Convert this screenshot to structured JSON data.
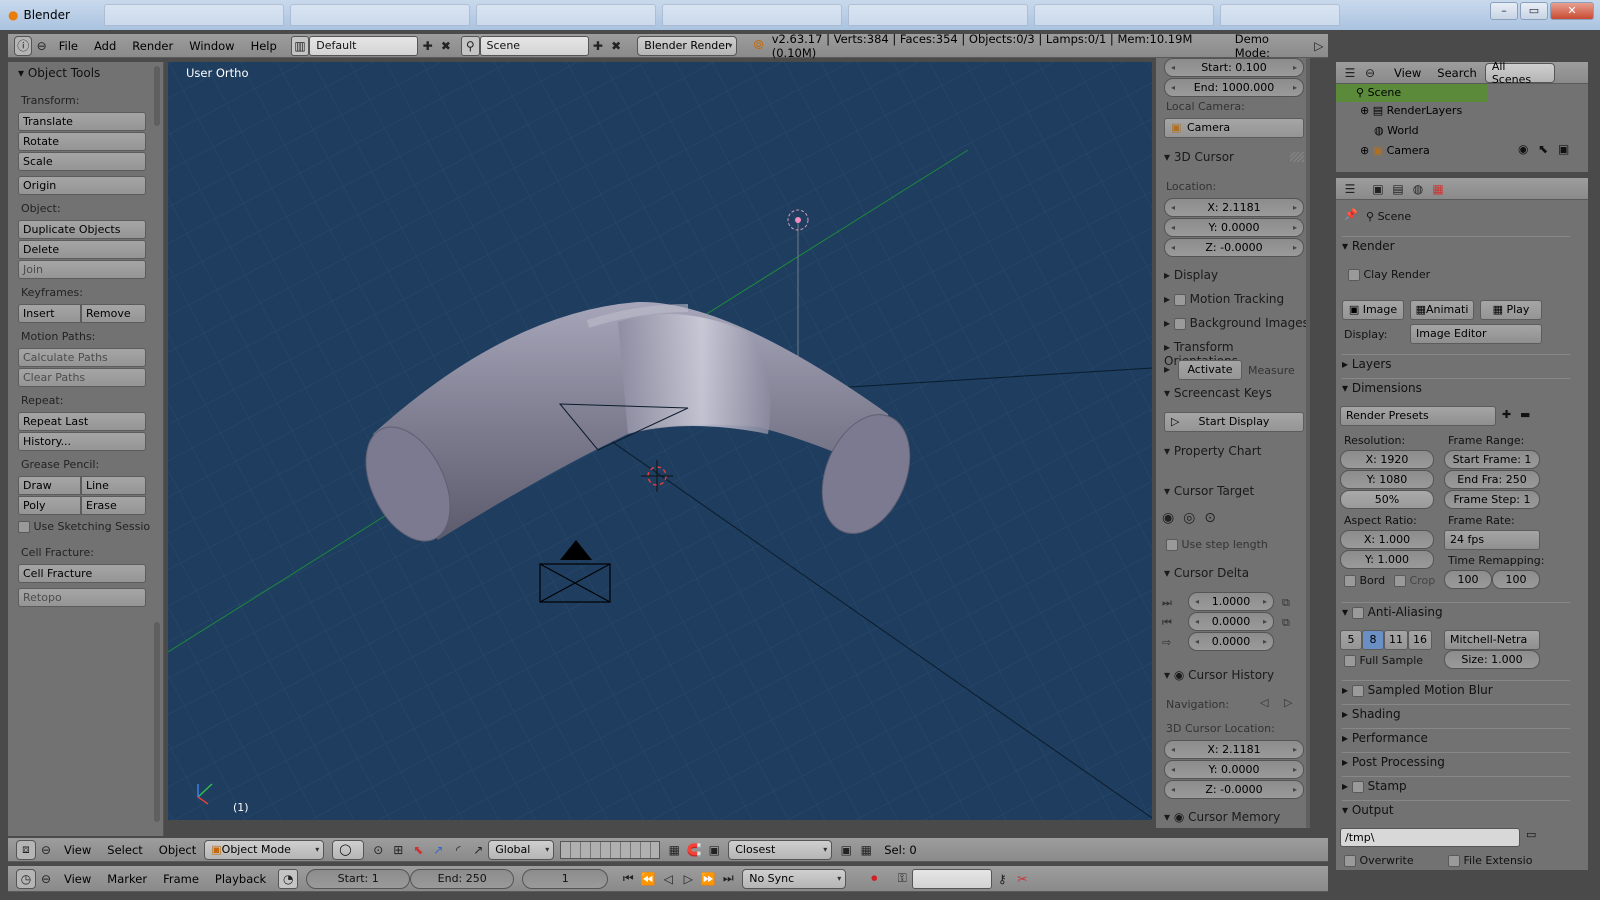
{
  "window": {
    "title": "Blender",
    "buttons": {
      "minimize": "–",
      "maximize": "▭",
      "close": "✕"
    }
  },
  "info_header": {
    "menus": [
      "File",
      "Add",
      "Render",
      "Window",
      "Help"
    ],
    "layout": "Default",
    "scene": "Scene",
    "engine": "Blender Render",
    "stats": "v2.63.17 | Verts:384 | Faces:354 | Objects:0/3 | Lamps:0/1 | Mem:10.19M (0.10M)",
    "demo_mode": "Demo Mode:"
  },
  "tool_shelf": {
    "title": "Object Tools",
    "transform_label": "Transform:",
    "translate": "Translate",
    "rotate": "Rotate",
    "scale": "Scale",
    "origin": "Origin",
    "object_label": "Object:",
    "duplicate": "Duplicate Objects",
    "delete": "Delete",
    "join": "Join",
    "keyframes_label": "Keyframes:",
    "insert": "Insert",
    "remove": "Remove",
    "motion_paths_label": "Motion Paths:",
    "calculate_paths": "Calculate Paths",
    "clear_paths": "Clear Paths",
    "repeat_label": "Repeat:",
    "repeat_last": "Repeat Last",
    "history": "History...",
    "grease_pencil_label": "Grease Pencil:",
    "draw": "Draw",
    "line": "Line",
    "poly": "Poly",
    "erase": "Erase",
    "use_sketching": "Use Sketching Sessio",
    "cell_fracture_label": "Cell Fracture:",
    "cell_fracture": "Cell Fracture",
    "retopo": "Retopo"
  },
  "viewport": {
    "label": "User Ortho",
    "frame": "(1)"
  },
  "n_panel": {
    "start": "Start: 0.100",
    "end": "End: 1000.000",
    "local_camera_label": "Local Camera:",
    "camera": "Camera",
    "cursor_section": "3D Cursor",
    "location_label": "Location:",
    "x": "X: 2.1181",
    "y": "Y: 0.0000",
    "z": "Z: -0.0000",
    "display": "Display",
    "motion_tracking": "Motion Tracking",
    "background_images": "Background Images",
    "transform_orientations": "Transform Orientations",
    "activate": "Activate",
    "measure": "Measure",
    "screencast_keys": "Screencast Keys",
    "start_display": "Start Display",
    "property_chart": "Property Chart",
    "cursor_target": "Cursor Target",
    "use_step_length": "Use step length",
    "cursor_delta": "Cursor Delta",
    "delta_values": [
      "1.0000",
      "0.0000",
      "0.0000"
    ],
    "cursor_history": "Cursor History",
    "navigation_label": "Navigation:",
    "cursor_location_label": "3D Cursor Location:",
    "hx": "X: 2.1181",
    "hy": "Y: 0.0000",
    "hz": "Z: -0.0000",
    "cursor_memory": "Cursor Memory"
  },
  "outliner": {
    "view": "View",
    "search": "Search",
    "filter": "All Scenes",
    "items": [
      "Scene",
      "RenderLayers",
      "World",
      "Camera"
    ]
  },
  "properties": {
    "scene": "Scene",
    "render": "Render",
    "clay_render": "Clay Render",
    "image": "Image",
    "animation": "Animati",
    "play": "Play",
    "display_label": "Display:",
    "display_value": "Image Editor",
    "layers": "Layers",
    "dimensions": "Dimensions",
    "render_presets": "Render Presets",
    "resolution_label": "Resolution:",
    "res_x": "X: 1920",
    "res_y": "Y: 1080",
    "res_pct": "50%",
    "frame_range_label": "Frame Range:",
    "start_frame": "Start Frame: 1",
    "end_frame": "End Fra: 250",
    "frame_step": "Frame Step: 1",
    "aspect_label": "Aspect Ratio:",
    "asp_x": "X: 1.000",
    "asp_y": "Y: 1.000",
    "frame_rate_label": "Frame Rate:",
    "frame_rate": "24 fps",
    "time_remap_label": "Time Remapping:",
    "bord": "Bord",
    "crop": "Crop",
    "remap_old": "100",
    "remap_new": "100",
    "anti_aliasing": "Anti-Aliasing",
    "aa_samples": [
      "5",
      "8",
      "11",
      "16"
    ],
    "aa_filter": "Mitchell-Netra",
    "full_sample": "Full Sample",
    "aa_size": "Size: 1.000",
    "sampled_motion_blur": "Sampled Motion Blur",
    "shading": "Shading",
    "performance": "Performance",
    "post_processing": "Post Processing",
    "stamp": "Stamp",
    "output": "Output",
    "output_path": "/tmp\\",
    "overwrite": "Overwrite",
    "file_extension": "File Extensio"
  },
  "view3d_header": {
    "menus": [
      "View",
      "Select",
      "Object"
    ],
    "mode": "Object Mode",
    "orientation": "Global",
    "snap": "Closest",
    "sel": "Sel: 0"
  },
  "timeline": {
    "menus": [
      "View",
      "Marker",
      "Frame",
      "Playback"
    ],
    "start": "Start: 1",
    "end": "End: 250",
    "current": "1",
    "sync": "No Sync"
  }
}
